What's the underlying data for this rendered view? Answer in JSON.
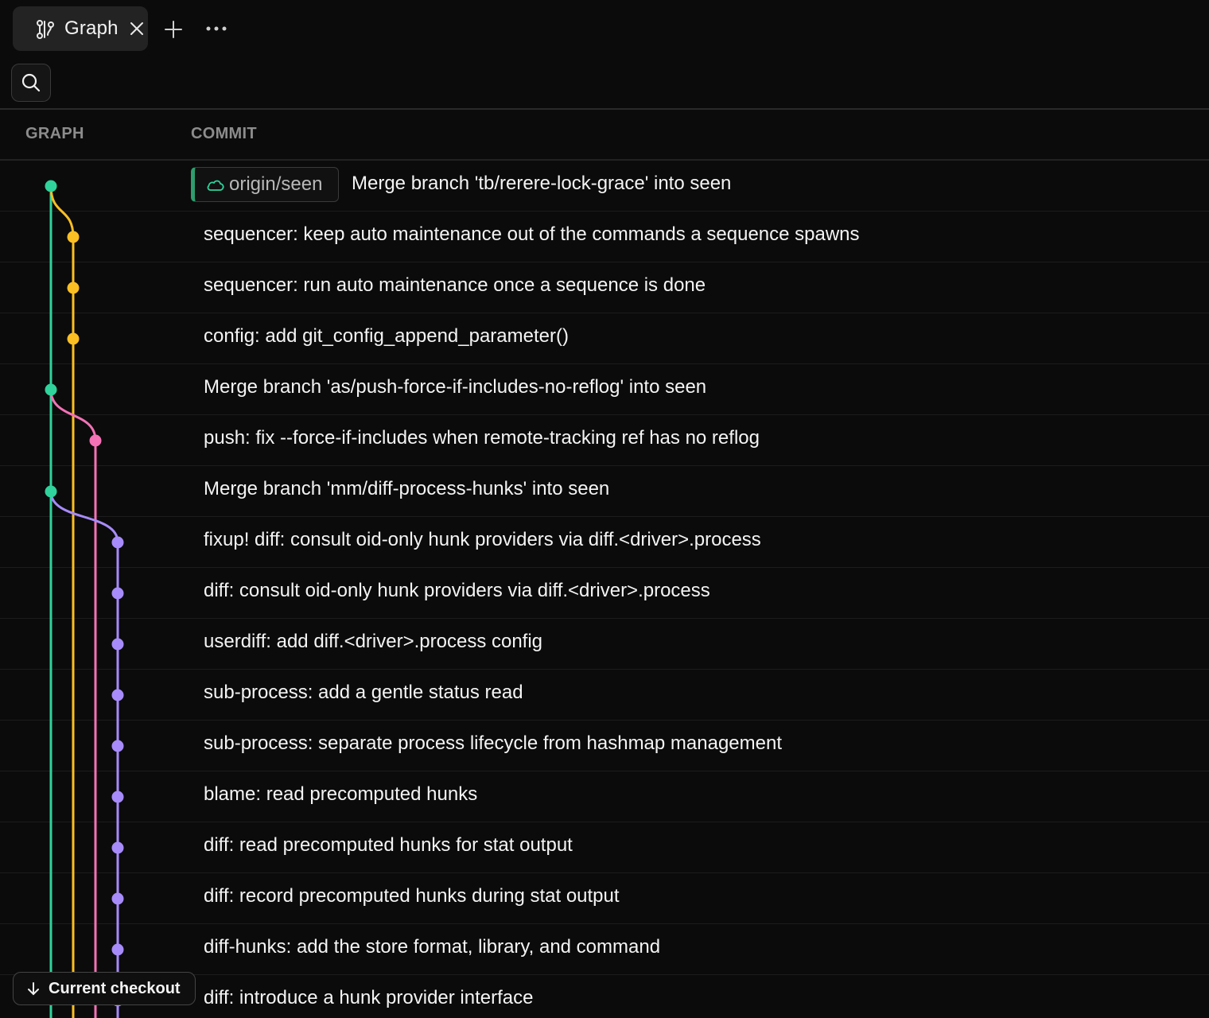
{
  "tab": {
    "title": "Graph",
    "icon": "git-branch-icon"
  },
  "toolbar": {
    "search_icon": "search-icon",
    "more_icon": "ellipsis-icon",
    "new_tab_icon": "plus-icon"
  },
  "columns": {
    "graph": "GRAPH",
    "commit": "COMMIT"
  },
  "colors": {
    "main": "#2fd39b",
    "branch_yellow": "#fbbf24",
    "branch_pink": "#f472b6",
    "branch_purple": "#a78bfa",
    "ref_accent": "#2e9e6e"
  },
  "ref": {
    "label": "origin/seen",
    "icon": "cloud-icon"
  },
  "commits": [
    {
      "message": "Merge branch 'tb/rerere-lock-grace' into seen",
      "lane": "main"
    },
    {
      "message": "sequencer: keep auto maintenance out of the commands a sequence spawns",
      "lane": "yellow"
    },
    {
      "message": "sequencer: run auto maintenance once a sequence is done",
      "lane": "yellow"
    },
    {
      "message": "config: add git_config_append_parameter()",
      "lane": "yellow"
    },
    {
      "message": "Merge branch 'as/push-force-if-includes-no-reflog' into seen",
      "lane": "main"
    },
    {
      "message": "push: fix --force-if-includes when remote-tracking ref has no reflog",
      "lane": "pink"
    },
    {
      "message": "Merge branch 'mm/diff-process-hunks' into seen",
      "lane": "main"
    },
    {
      "message": "fixup! diff: consult oid-only hunk providers via diff.<driver>.process",
      "lane": "purple"
    },
    {
      "message": "diff: consult oid-only hunk providers via diff.<driver>.process",
      "lane": "purple"
    },
    {
      "message": "userdiff: add diff.<driver>.process config",
      "lane": "purple"
    },
    {
      "message": "sub-process: add a gentle status read",
      "lane": "purple"
    },
    {
      "message": "sub-process: separate process lifecycle from hashmap management",
      "lane": "purple"
    },
    {
      "message": "blame: read precomputed hunks",
      "lane": "purple"
    },
    {
      "message": "diff: read precomputed hunks for stat output",
      "lane": "purple"
    },
    {
      "message": "diff: record precomputed hunks during stat output",
      "lane": "purple"
    },
    {
      "message": "diff-hunks: add the store format, library, and command",
      "lane": "purple"
    },
    {
      "message": "diff: introduce a hunk provider interface",
      "lane": "purple"
    }
  ],
  "checkout": {
    "label": "Current checkout",
    "icon": "arrow-down-icon"
  }
}
